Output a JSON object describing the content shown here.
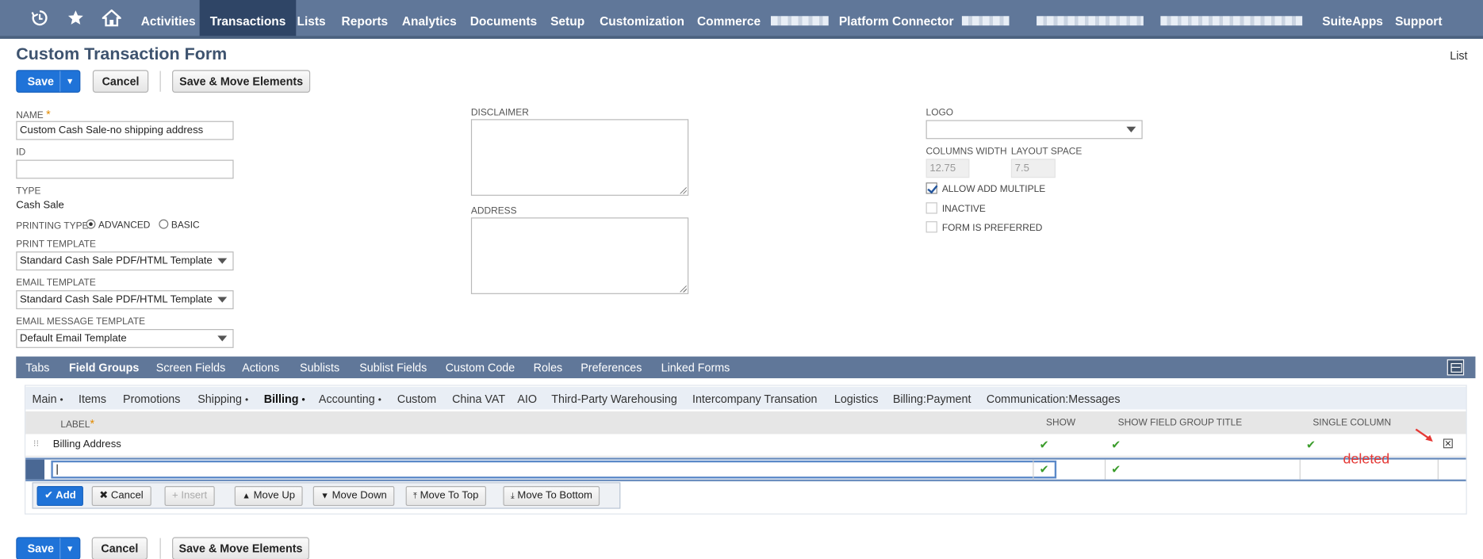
{
  "nav": {
    "items": [
      "Activities",
      "Transactions",
      "Lists",
      "Reports",
      "Analytics",
      "Documents",
      "Setup",
      "Customization",
      "Commerce",
      "Platform Connector",
      "SuiteApps",
      "Support"
    ],
    "active": "Transactions"
  },
  "page": {
    "title": "Custom Transaction Form",
    "list_link": "List"
  },
  "toolbar": {
    "save": "Save",
    "cancel": "Cancel",
    "save_move": "Save & Move Elements"
  },
  "form": {
    "name_label": "NAME",
    "name_value": "Custom Cash Sale-no shipping address",
    "id_label": "ID",
    "id_value": "",
    "type_label": "TYPE",
    "type_value": "Cash Sale",
    "printing_type_label": "PRINTING TYPE",
    "printing_advanced": "ADVANCED",
    "printing_basic": "BASIC",
    "print_template_label": "PRINT TEMPLATE",
    "print_template_value": "Standard Cash Sale PDF/HTML Template",
    "email_template_label": "EMAIL TEMPLATE",
    "email_template_value": "Standard Cash Sale PDF/HTML Template",
    "email_message_label": "EMAIL MESSAGE TEMPLATE",
    "email_message_value": "Default Email Template",
    "disclaimer_label": "DISCLAIMER",
    "address_label": "ADDRESS",
    "logo_label": "LOGO",
    "columns_width_label": "COLUMNS WIDTH",
    "columns_width_value": "12.75",
    "layout_space_label": "LAYOUT SPACE",
    "layout_space_value": "7.5",
    "allow_add_multiple": "ALLOW ADD MULTIPLE",
    "inactive": "INACTIVE",
    "form_is_preferred": "FORM IS PREFERRED"
  },
  "tabs": [
    "Tabs",
    "Field Groups",
    "Screen Fields",
    "Actions",
    "Sublists",
    "Sublist Fields",
    "Custom Code",
    "Roles",
    "Preferences",
    "Linked Forms"
  ],
  "subtabs": [
    "Main",
    "Items",
    "Promotions",
    "Shipping",
    "Billing",
    "Accounting",
    "Custom",
    "China VAT",
    "AIO",
    "Third-Party Warehousing",
    "Intercompany Transation",
    "Logistics",
    "Billing:Payment",
    "Communication:Messages"
  ],
  "grid": {
    "headers": {
      "label": "LABEL",
      "show": "SHOW",
      "show_title": "SHOW FIELD GROUP TITLE",
      "single_column": "SINGLE COLUMN"
    },
    "rows": [
      {
        "label": "Billing Address"
      }
    ],
    "check": "✔",
    "delete_icon": "✕"
  },
  "grid_buttons": {
    "add": "Add",
    "cancel": "Cancel",
    "insert": "Insert",
    "move_up": "Move Up",
    "move_down": "Move Down",
    "move_top": "Move To Top",
    "move_bottom": "Move To Bottom"
  },
  "annotation": {
    "text": "deleted",
    "color": "#e53935"
  },
  "colors": {
    "nav_bg": "#607799",
    "nav_active": "#2f4566",
    "primary_button": "#1f73d8",
    "title": "#3e536f"
  }
}
